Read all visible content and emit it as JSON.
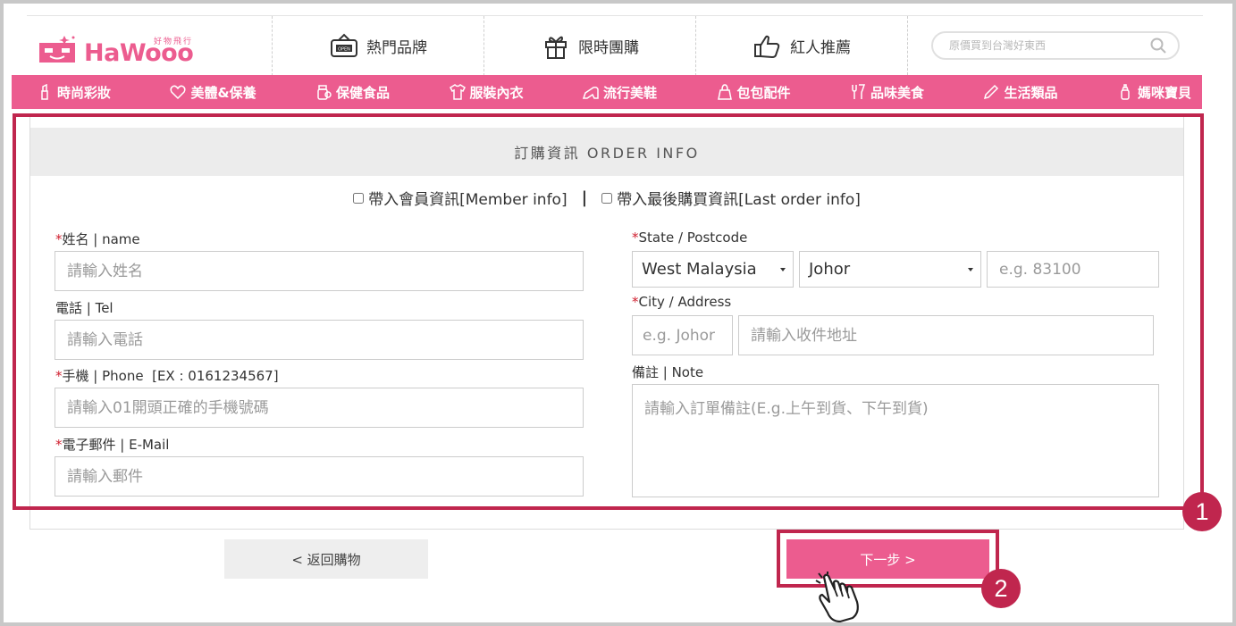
{
  "brand": {
    "name": "HaWooo",
    "sub": "好物飛行"
  },
  "nav_top": [
    {
      "label": "熱門品牌",
      "icon": "open-sign-icon"
    },
    {
      "label": "限時團購",
      "icon": "gift-icon"
    },
    {
      "label": "紅人推薦",
      "icon": "thumbs-up-icon"
    }
  ],
  "search": {
    "placeholder": "原價買到台灣好東西",
    "icon": "search-icon"
  },
  "categories": [
    {
      "label": "時尚彩妝",
      "icon": "lipstick-icon"
    },
    {
      "label": "美體&保養",
      "icon": "heart-icon"
    },
    {
      "label": "保健食品",
      "icon": "supplement-icon"
    },
    {
      "label": "服裝內衣",
      "icon": "shirt-icon"
    },
    {
      "label": "流行美鞋",
      "icon": "heel-shoe-icon"
    },
    {
      "label": "包包配件",
      "icon": "bag-icon"
    },
    {
      "label": "品味美食",
      "icon": "cutlery-icon"
    },
    {
      "label": "生活類品",
      "icon": "pencil-icon"
    },
    {
      "label": "媽咪寶貝",
      "icon": "baby-bottle-icon"
    }
  ],
  "form": {
    "heading": "訂購資訊 ORDER INFO",
    "member_check": "帶入會員資訊[Member info]",
    "separator": "|",
    "last_order_check": "帶入最後購買資訊[Last order info]",
    "required_mark": "*",
    "name_label": "姓名 | name",
    "name_placeholder": "請輸入姓名",
    "tel_label": "電話 | Tel",
    "tel_placeholder": "請輸入電話",
    "phone_label": "手機 | Phone  [EX : 0161234567]",
    "phone_placeholder": "請輸入01開頭正確的手機號碼",
    "email_label": "電子郵件 | E-Mail",
    "email_placeholder": "請輸入郵件",
    "state_label": "State / Postcode",
    "state_value": "West Malaysia",
    "region_value": "Johor",
    "postcode_placeholder": "e.g. 83100",
    "city_label": "City / Address",
    "city_placeholder": "e.g. Johor",
    "address_placeholder": "請輸入收件地址",
    "note_label": "備註 | Note",
    "note_placeholder": "請輸入訂單備註(E.g.上午到貨、下午到貨)"
  },
  "buttons": {
    "back": "< 返回購物",
    "next": "下一步 >"
  },
  "annotations": {
    "step1": "1",
    "step2": "2"
  },
  "colors": {
    "brand_pink": "#ec5c8f",
    "annotation_red": "#c0264e"
  }
}
